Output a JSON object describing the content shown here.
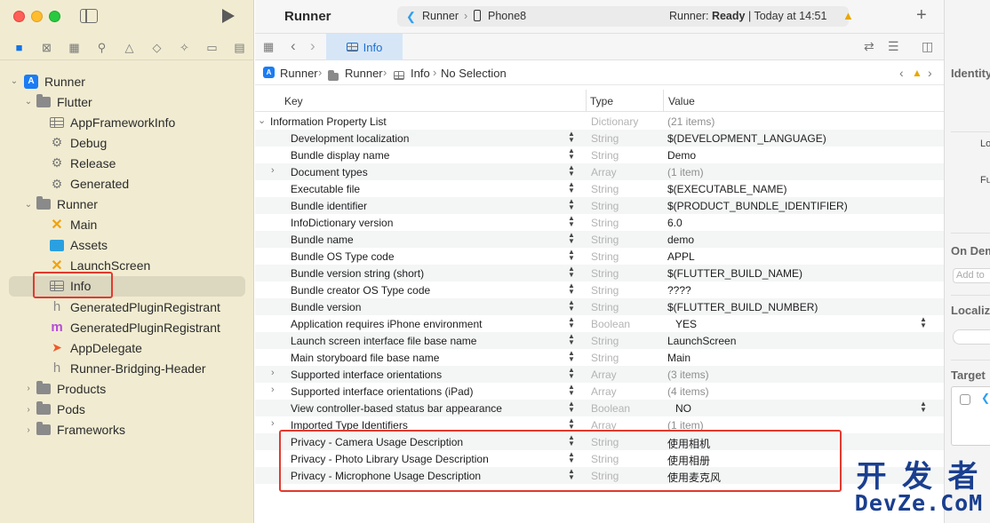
{
  "app": {
    "title": "Runner"
  },
  "scheme": {
    "target": "Runner",
    "device": "Phone8",
    "status_prefix": "Runner: ",
    "status_bold": "Ready",
    "status_suffix": " | Today at 14:51"
  },
  "tabs": [
    {
      "label": "Info",
      "active": true
    }
  ],
  "breadcrumb": {
    "items": [
      "Runner",
      "Runner",
      "Info",
      "No Selection"
    ]
  },
  "sidebar": {
    "items": [
      {
        "label": "Runner",
        "icon": "project-icon",
        "level": 0,
        "expanded": true
      },
      {
        "label": "Flutter",
        "icon": "folder-icon",
        "level": 1,
        "expanded": true
      },
      {
        "label": "AppFrameworkInfo",
        "icon": "plist-icon",
        "level": 2
      },
      {
        "label": "Debug",
        "icon": "xcconfig-icon",
        "level": 2
      },
      {
        "label": "Release",
        "icon": "xcconfig-icon",
        "level": 2
      },
      {
        "label": "Generated",
        "icon": "xcconfig-icon",
        "level": 2
      },
      {
        "label": "Runner",
        "icon": "folder-icon",
        "level": 1,
        "expanded": true
      },
      {
        "label": "Main",
        "icon": "storyboard-icon",
        "level": 2
      },
      {
        "label": "Assets",
        "icon": "assets-icon",
        "level": 2
      },
      {
        "label": "LaunchScreen",
        "icon": "storyboard-icon",
        "level": 2
      },
      {
        "label": "Info",
        "icon": "plist-icon",
        "level": 2,
        "selected": true
      },
      {
        "label": "GeneratedPluginRegistrant",
        "icon": "header-icon",
        "level": 2
      },
      {
        "label": "GeneratedPluginRegistrant",
        "icon": "objc-file-icon",
        "level": 2
      },
      {
        "label": "AppDelegate",
        "icon": "swift-icon",
        "level": 2
      },
      {
        "label": "Runner-Bridging-Header",
        "icon": "header-icon",
        "level": 2
      },
      {
        "label": "Products",
        "icon": "folder-icon",
        "level": 1,
        "expanded": false
      },
      {
        "label": "Pods",
        "icon": "folder-icon",
        "level": 1,
        "expanded": false
      },
      {
        "label": "Frameworks",
        "icon": "folder-icon",
        "level": 1,
        "expanded": false
      }
    ]
  },
  "plist": {
    "columns": {
      "key": "Key",
      "type": "Type",
      "value": "Value"
    },
    "root": {
      "key": "Information Property List",
      "type": "Dictionary",
      "value": "(21 items)"
    },
    "rows": [
      {
        "key": "Development localization",
        "type": "String",
        "value": "$(DEVELOPMENT_LANGUAGE)"
      },
      {
        "key": "Bundle display name",
        "type": "String",
        "value": "Demo"
      },
      {
        "key": "Document types",
        "type": "Array",
        "value": "(1 item)"
      },
      {
        "key": "Executable file",
        "type": "String",
        "value": "$(EXECUTABLE_NAME)"
      },
      {
        "key": "Bundle identifier",
        "type": "String",
        "value": "$(PRODUCT_BUNDLE_IDENTIFIER)"
      },
      {
        "key": "InfoDictionary version",
        "type": "String",
        "value": "6.0"
      },
      {
        "key": "Bundle name",
        "type": "String",
        "value": "demo"
      },
      {
        "key": "Bundle OS Type code",
        "type": "String",
        "value": "APPL"
      },
      {
        "key": "Bundle version string (short)",
        "type": "String",
        "value": "$(FLUTTER_BUILD_NAME)"
      },
      {
        "key": "Bundle creator OS Type code",
        "type": "String",
        "value": "????"
      },
      {
        "key": "Bundle version",
        "type": "String",
        "value": "$(FLUTTER_BUILD_NUMBER)"
      },
      {
        "key": "Application requires iPhone environment",
        "type": "Boolean",
        "value": "YES"
      },
      {
        "key": "Launch screen interface file base name",
        "type": "String",
        "value": "LaunchScreen"
      },
      {
        "key": "Main storyboard file base name",
        "type": "String",
        "value": "Main"
      },
      {
        "key": "Supported interface orientations",
        "type": "Array",
        "value": "(3 items)"
      },
      {
        "key": "Supported interface orientations (iPad)",
        "type": "Array",
        "value": "(4 items)"
      },
      {
        "key": "View controller-based status bar appearance",
        "type": "Boolean",
        "value": "NO"
      },
      {
        "key": "Imported Type Identifiers",
        "type": "Array",
        "value": "(1 item)"
      },
      {
        "key": "Privacy - Camera Usage Description",
        "type": "String",
        "value": "使用相机"
      },
      {
        "key": "Privacy - Photo Library Usage Description",
        "type": "String",
        "value": "使用相册"
      },
      {
        "key": "Privacy - Microphone Usage Description",
        "type": "String",
        "value": "使用麦克风"
      }
    ]
  },
  "inspector": {
    "identity": "Identity",
    "loc_label": "Lo",
    "full_label": "Fu",
    "on_demand": "On Dem",
    "add_tags_placeholder": "Add to",
    "localization": "Localiz",
    "target_membership": "Target"
  },
  "watermark": {
    "line1": "开 发 者",
    "line2": "DevZe.CoM"
  },
  "colors": {
    "annotation": "#e23a2e",
    "accent": "#1473e6",
    "sidebar_bg": "#f1ecd1"
  }
}
